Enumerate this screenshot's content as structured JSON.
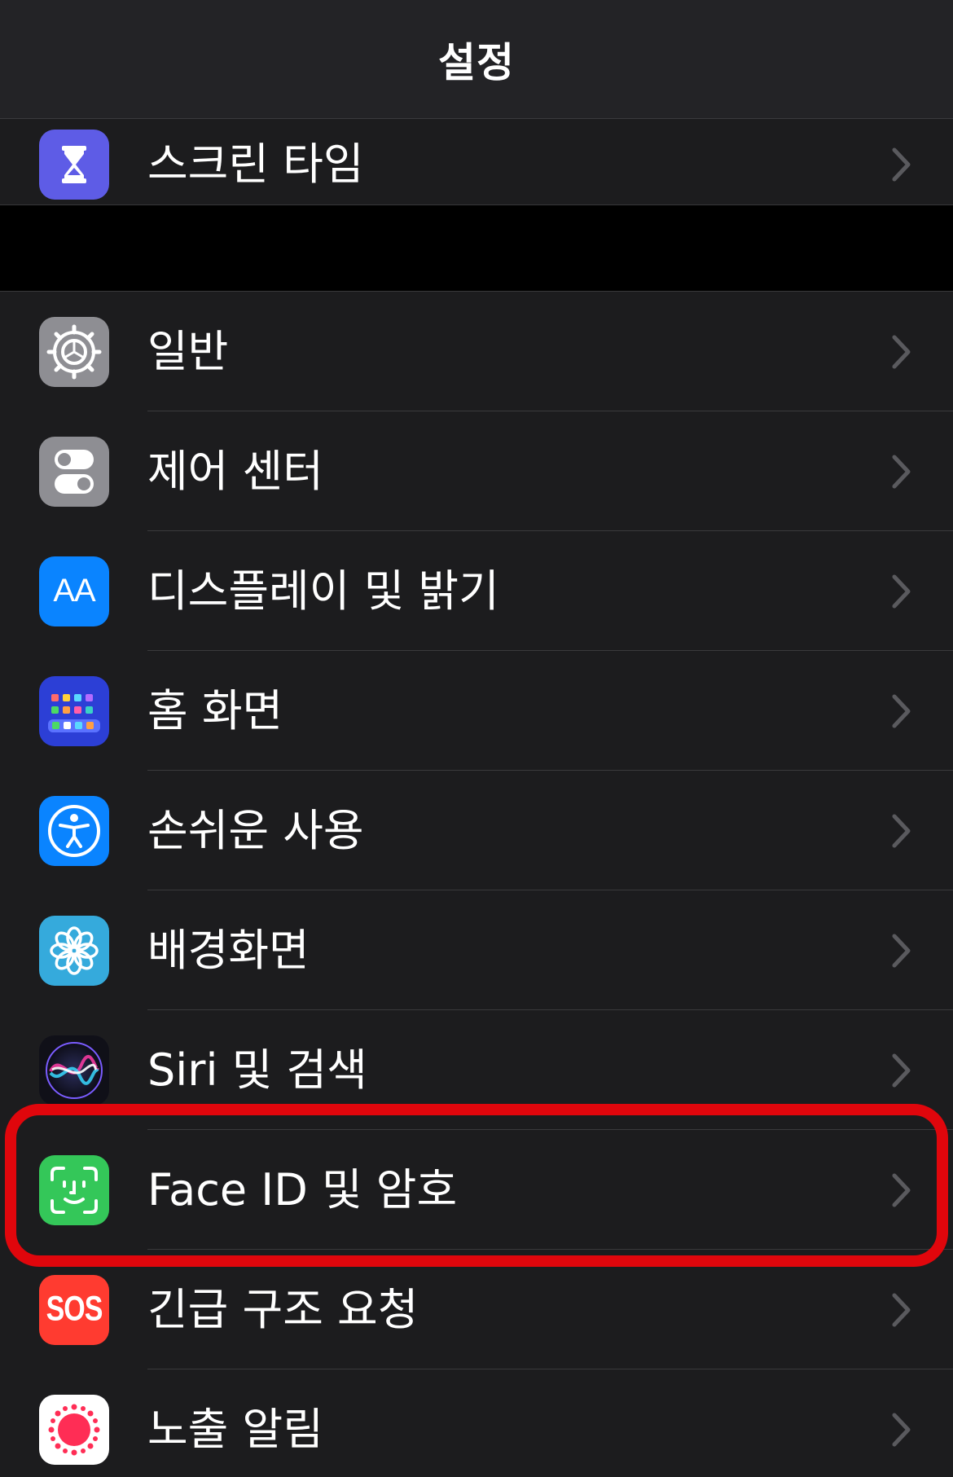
{
  "header": {
    "title": "설정"
  },
  "top_group": [
    {
      "label": "스크린 타임",
      "icon": "hourglass-icon",
      "icon_color": "#5e5ce6"
    }
  ],
  "main_group": [
    {
      "label": "일반",
      "icon": "gear-icon",
      "icon_color": "#8e8e93"
    },
    {
      "label": "제어 센터",
      "icon": "toggles-icon",
      "icon_color": "#8e8e93"
    },
    {
      "label": "디스플레이 및 밝기",
      "icon": "aa-text-icon",
      "icon_color": "#0a84ff",
      "icon_text": "AA"
    },
    {
      "label": "홈 화면",
      "icon": "home-screen-grid-icon",
      "icon_color": "#2c3fd6"
    },
    {
      "label": "손쉬운 사용",
      "icon": "accessibility-icon",
      "icon_color": "#0a84ff"
    },
    {
      "label": "배경화면",
      "icon": "flower-icon",
      "icon_color": "#35aadc"
    },
    {
      "label": "Siri 및 검색",
      "icon": "siri-icon",
      "icon_color": "#1c1c2e"
    },
    {
      "label": "Face ID 및 암호",
      "icon": "face-id-icon",
      "icon_color": "#34c759",
      "highlighted": true
    },
    {
      "label": "긴급 구조 요청",
      "icon": "sos-icon",
      "icon_color": "#ff3b30",
      "icon_text": "SOS"
    },
    {
      "label": "노출 알림",
      "icon": "exposure-notification-icon",
      "icon_color": "#ffffff"
    }
  ],
  "colors": {
    "highlight": "#e0060c",
    "chevron": "#5a5a5e"
  }
}
